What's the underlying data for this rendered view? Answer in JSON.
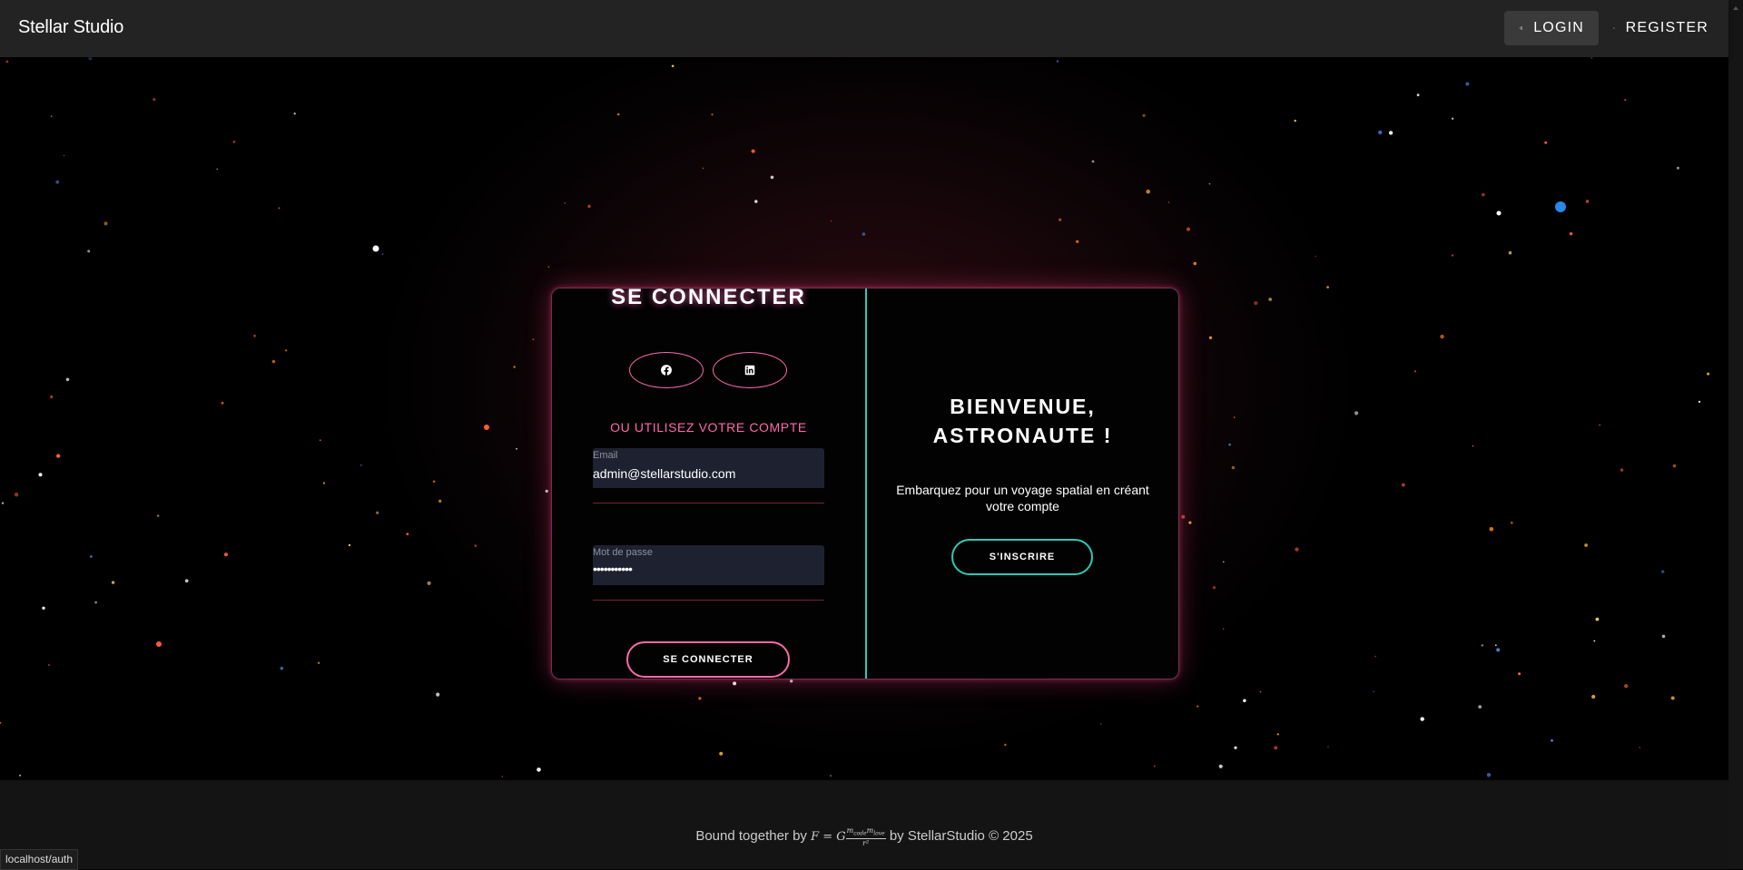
{
  "app": {
    "brand": "Stellar Studio",
    "login": "LOGIN",
    "register": "REGISTER"
  },
  "login_form": {
    "title": "SE CONNECTER",
    "social": [
      "facebook-icon",
      "linkedin-icon"
    ],
    "or_text": "OU UTILISEZ VOTRE COMPTE",
    "email_label": "Email",
    "email_value": "admin@stellarstudio.com",
    "password_label": "Mot de passe",
    "password_value": "•••••••••••",
    "submit": "SE CONNECTER"
  },
  "welcome": {
    "title_line1": "BIENVENUE,",
    "title_line2": "ASTRONAUTE !",
    "text": "Embarquez pour un voyage spatial en créant votre compte",
    "signup": "S'INSCRIRE"
  },
  "footer": {
    "prefix": "Bound together by",
    "suffix": "by StellarStudio © 2025",
    "formula_lhs": "F = G",
    "formula_num": "m",
    "formula_num_sub1": "code",
    "formula_num_sub2": "love",
    "formula_den": "r²"
  },
  "status_url": "localhost/auth",
  "colors": {
    "accent_pink": "#ff6aa9",
    "accent_teal": "#2fc8b8",
    "appbar": "#232323",
    "field_bg": "#1e2230"
  }
}
